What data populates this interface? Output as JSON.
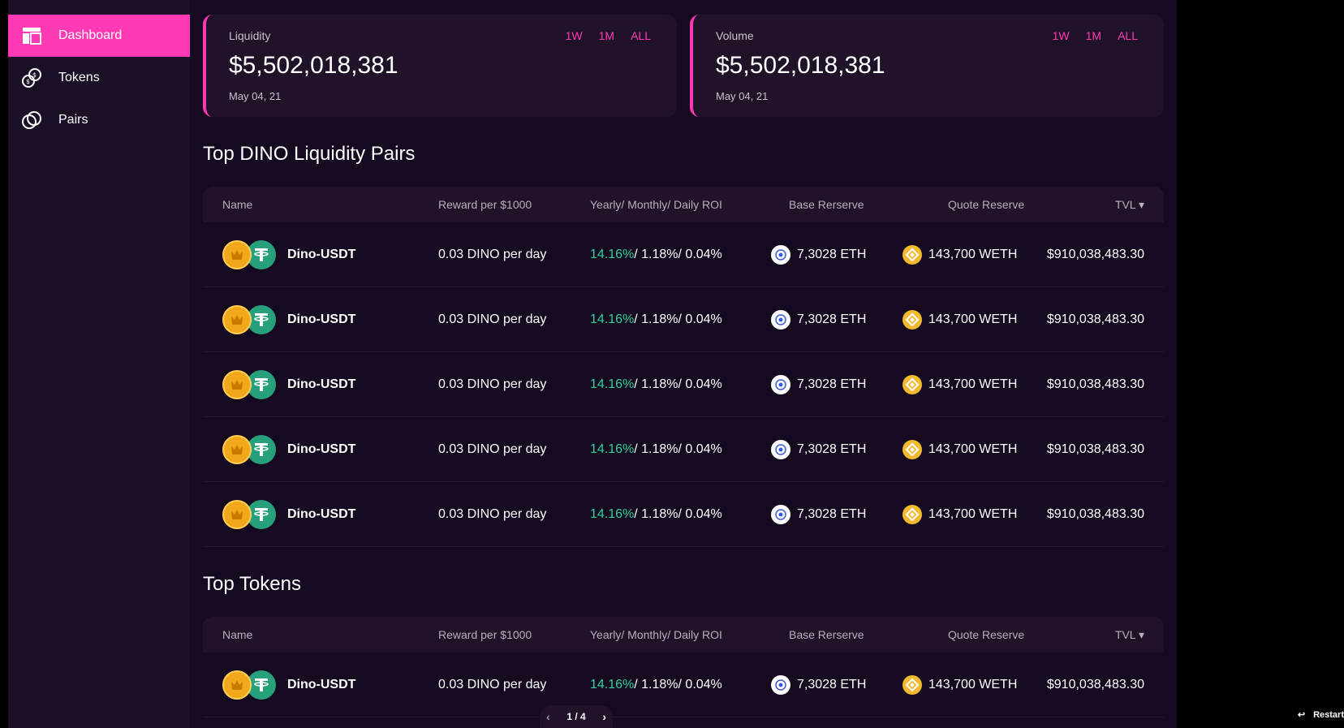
{
  "sidebar": {
    "items": [
      {
        "label": "Dashboard",
        "icon": "dashboard-icon",
        "active": true
      },
      {
        "label": "Tokens",
        "icon": "coins-icon",
        "active": false
      },
      {
        "label": "Pairs",
        "icon": "link-icon",
        "active": false
      }
    ]
  },
  "cards": [
    {
      "label": "Liquidity",
      "value": "$5,502,018,381",
      "date": "May 04, 21",
      "ranges": [
        "1W",
        "1M",
        "ALL"
      ]
    },
    {
      "label": "Volume",
      "value": "$5,502,018,381",
      "date": "May 04, 21",
      "ranges": [
        "1W",
        "1M",
        "ALL"
      ]
    }
  ],
  "pairs_section": {
    "title": "Top DINO Liquidity Pairs",
    "columns": [
      "Name",
      "Reward per $1000",
      "Yearly/ Monthly/ Daily ROI",
      "Base Rerserve",
      "Quote Reserve",
      "TVL ▾"
    ],
    "rows": [
      {
        "name": "Dino-USDT",
        "reward": "0.03 DINO per day",
        "roi_yearly": "14.16%",
        "roi_rest": "/ 1.18%/ 0.04%",
        "base": "7,3028 ETH",
        "quote": "143,700 WETH",
        "tvl": "$910,038,483.30"
      },
      {
        "name": "Dino-USDT",
        "reward": "0.03 DINO per day",
        "roi_yearly": "14.16%",
        "roi_rest": "/ 1.18%/ 0.04%",
        "base": "7,3028 ETH",
        "quote": "143,700 WETH",
        "tvl": "$910,038,483.30"
      },
      {
        "name": "Dino-USDT",
        "reward": "0.03 DINO per day",
        "roi_yearly": "14.16%",
        "roi_rest": "/ 1.18%/ 0.04%",
        "base": "7,3028 ETH",
        "quote": "143,700 WETH",
        "tvl": "$910,038,483.30"
      },
      {
        "name": "Dino-USDT",
        "reward": "0.03 DINO per day",
        "roi_yearly": "14.16%",
        "roi_rest": "/ 1.18%/ 0.04%",
        "base": "7,3028 ETH",
        "quote": "143,700 WETH",
        "tvl": "$910,038,483.30"
      },
      {
        "name": "Dino-USDT",
        "reward": "0.03 DINO per day",
        "roi_yearly": "14.16%",
        "roi_rest": "/ 1.18%/ 0.04%",
        "base": "7,3028 ETH",
        "quote": "143,700 WETH",
        "tvl": "$910,038,483.30"
      }
    ]
  },
  "tokens_section": {
    "title": "Top Tokens",
    "columns": [
      "Name",
      "Reward per $1000",
      "Yearly/ Monthly/ Daily ROI",
      "Base Rerserve",
      "Quote Reserve",
      "TVL ▾"
    ],
    "rows": [
      {
        "name": "Dino-USDT",
        "reward": "0.03 DINO per day",
        "roi_yearly": "14.16%",
        "roi_rest": "/ 1.18%/ 0.04%",
        "base": "7,3028 ETH",
        "quote": "143,700 WETH",
        "tvl": "$910,038,483.30"
      }
    ]
  },
  "pager": {
    "text": "1 / 4",
    "prev": "‹",
    "next": "›"
  },
  "restart": {
    "label": "Restart",
    "icon": "↩"
  },
  "colors": {
    "accent": "#ff3ab4",
    "roi_green": "#2ed39e",
    "background": "#150a20",
    "card": "#1f1229"
  }
}
